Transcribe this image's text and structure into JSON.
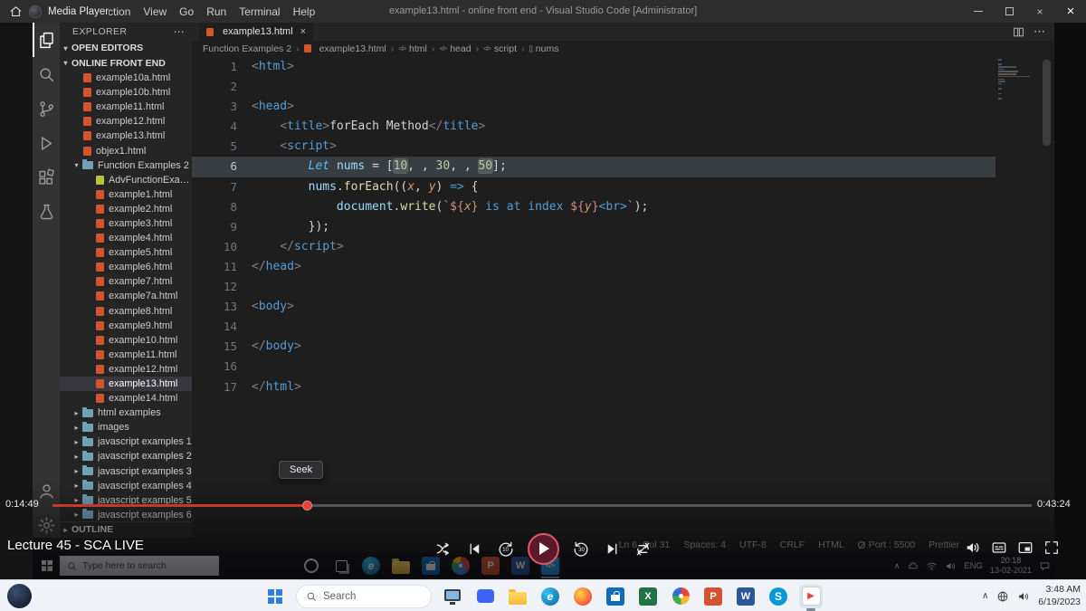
{
  "titlebar": {
    "app": "Media Player",
    "menus": [
      "Selection",
      "View",
      "Go",
      "Run",
      "Terminal",
      "Help"
    ],
    "title": "example13.html - online front end - Visual Studio Code [Administrator]"
  },
  "activity": {
    "top": [
      {
        "name": "explorer",
        "active": true
      },
      {
        "name": "search",
        "active": false
      },
      {
        "name": "source-control",
        "active": false
      },
      {
        "name": "run-debug",
        "active": false
      },
      {
        "name": "extensions",
        "active": false
      },
      {
        "name": "testing",
        "active": false
      }
    ],
    "bottom": [
      {
        "name": "account"
      },
      {
        "name": "settings"
      }
    ]
  },
  "sidebar": {
    "header": "EXPLORER",
    "open_editors": "OPEN EDITORS",
    "root": "ONLINE FRONT END",
    "outline": "OUTLINE",
    "tree": [
      {
        "label": "example10a.html",
        "icon": "html",
        "indent": 1
      },
      {
        "label": "example10b.html",
        "icon": "html",
        "indent": 1
      },
      {
        "label": "example11.html",
        "icon": "html",
        "indent": 1
      },
      {
        "label": "example12.html",
        "icon": "html",
        "indent": 1
      },
      {
        "label": "example13.html",
        "icon": "html",
        "indent": 1
      },
      {
        "label": "objex1.html",
        "icon": "html",
        "indent": 1
      },
      {
        "label": "Function Examples 2",
        "icon": "folder",
        "indent": 1,
        "arrow": "down"
      },
      {
        "label": "AdvFunctionExample...",
        "icon": "js",
        "indent": 2
      },
      {
        "label": "example1.html",
        "icon": "html",
        "indent": 2
      },
      {
        "label": "example2.html",
        "icon": "html",
        "indent": 2
      },
      {
        "label": "example3.html",
        "icon": "html",
        "indent": 2
      },
      {
        "label": "example4.html",
        "icon": "html",
        "indent": 2
      },
      {
        "label": "example5.html",
        "icon": "html",
        "indent": 2
      },
      {
        "label": "example6.html",
        "icon": "html",
        "indent": 2
      },
      {
        "label": "example7.html",
        "icon": "html",
        "indent": 2
      },
      {
        "label": "example7a.html",
        "icon": "html",
        "indent": 2
      },
      {
        "label": "example8.html",
        "icon": "html",
        "indent": 2
      },
      {
        "label": "example9.html",
        "icon": "html",
        "indent": 2
      },
      {
        "label": "example10.html",
        "icon": "html",
        "indent": 2
      },
      {
        "label": "example11.html",
        "icon": "html",
        "indent": 2
      },
      {
        "label": "example12.html",
        "icon": "html",
        "indent": 2
      },
      {
        "label": "example13.html",
        "icon": "html",
        "indent": 2,
        "selected": true
      },
      {
        "label": "example14.html",
        "icon": "html",
        "indent": 2
      },
      {
        "label": "html examples",
        "icon": "folder",
        "indent": 1,
        "arrow": "right"
      },
      {
        "label": "images",
        "icon": "folder",
        "indent": 1,
        "arrow": "right"
      },
      {
        "label": "javascript examples 1",
        "icon": "folder",
        "indent": 1,
        "arrow": "right"
      },
      {
        "label": "javascript examples 2",
        "icon": "folder",
        "indent": 1,
        "arrow": "right"
      },
      {
        "label": "javascript examples 3",
        "icon": "folder",
        "indent": 1,
        "arrow": "right"
      },
      {
        "label": "javascript examples 4",
        "icon": "folder",
        "indent": 1,
        "arrow": "right"
      },
      {
        "label": "javascript examples 5",
        "icon": "folder",
        "indent": 1,
        "arrow": "right"
      },
      {
        "label": "javascript examples 6",
        "icon": "folder",
        "indent": 1,
        "arrow": "right"
      }
    ]
  },
  "editor": {
    "tab": {
      "label": "example13.html"
    },
    "breadcrumbs": [
      "Function Examples 2",
      "example13.html",
      "html",
      "head",
      "script",
      "nums"
    ],
    "active_line": 6,
    "lines": [
      [
        [
          "<",
          "punct"
        ],
        [
          "html",
          "tag"
        ],
        [
          ">",
          "punct"
        ]
      ],
      [],
      [
        [
          "<",
          "punct"
        ],
        [
          "head",
          "tag"
        ],
        [
          ">",
          "punct"
        ]
      ],
      [
        [
          "    ",
          "plain"
        ],
        [
          "<",
          "punct"
        ],
        [
          "title",
          "tag"
        ],
        [
          ">",
          "punct"
        ],
        [
          "forEach Method",
          "plain"
        ],
        [
          "</",
          "punct"
        ],
        [
          "title",
          "tag"
        ],
        [
          ">",
          "punct"
        ]
      ],
      [
        [
          "    ",
          "plain"
        ],
        [
          "<",
          "punct"
        ],
        [
          "script",
          "tag"
        ],
        [
          ">",
          "punct"
        ]
      ],
      [
        [
          "        ",
          "plain"
        ],
        [
          "Let",
          "let"
        ],
        [
          " ",
          "plain"
        ],
        [
          "nums",
          "var"
        ],
        [
          " = [",
          "plain"
        ],
        [
          "10",
          "num box"
        ],
        [
          ", , ",
          "plain"
        ],
        [
          "30",
          "num"
        ],
        [
          ", , ",
          "plain"
        ],
        [
          "50",
          "num box"
        ],
        [
          "];",
          "plain"
        ]
      ],
      [
        [
          "        ",
          "plain"
        ],
        [
          "nums",
          "var"
        ],
        [
          ".",
          "plain"
        ],
        [
          "forEach",
          "fn"
        ],
        [
          "((",
          "plain"
        ],
        [
          "x",
          "param"
        ],
        [
          ", ",
          "plain"
        ],
        [
          "y",
          "param"
        ],
        [
          ") ",
          "plain"
        ],
        [
          "=>",
          "blue"
        ],
        [
          " {",
          "plain"
        ]
      ],
      [
        [
          "            ",
          "plain"
        ],
        [
          "document",
          "var"
        ],
        [
          ".",
          "plain"
        ],
        [
          "write",
          "fn"
        ],
        [
          "(",
          "plain"
        ],
        [
          "`",
          "str"
        ],
        [
          "${",
          "str"
        ],
        [
          "x",
          "param"
        ],
        [
          "}",
          "str"
        ],
        [
          " is at index ",
          "blue"
        ],
        [
          "${",
          "str"
        ],
        [
          "y",
          "param"
        ],
        [
          "}",
          "str"
        ],
        [
          "<br>",
          "blue"
        ],
        [
          "`",
          "str"
        ],
        [
          ");",
          "plain"
        ]
      ],
      [
        [
          "        ",
          "plain"
        ],
        [
          "});",
          "plain"
        ]
      ],
      [
        [
          "    ",
          "plain"
        ],
        [
          "</",
          "punct"
        ],
        [
          "script",
          "tag"
        ],
        [
          ">",
          "punct"
        ]
      ],
      [
        [
          "</",
          "punct"
        ],
        [
          "head",
          "tag"
        ],
        [
          ">",
          "punct"
        ]
      ],
      [],
      [
        [
          "<",
          "punct"
        ],
        [
          "body",
          "tag"
        ],
        [
          ">",
          "punct"
        ]
      ],
      [],
      [
        [
          "</",
          "punct"
        ],
        [
          "body",
          "tag"
        ],
        [
          ">",
          "punct"
        ]
      ],
      [],
      [
        [
          "</",
          "punct"
        ],
        [
          "html",
          "tag"
        ],
        [
          ">",
          "punct"
        ]
      ]
    ],
    "status": [
      "Ln 6, Col 31",
      "Spaces: 4",
      "UTF-8",
      "CRLF",
      "HTML",
      "Port : 5500",
      "Prettier"
    ]
  },
  "player": {
    "elapsed": "0:14:49",
    "duration": "0:43:24",
    "progress_pct": 26,
    "seek_tooltip": "Seek",
    "now_playing": "Lecture 45 - SCA LIVE",
    "controls": [
      "shuffle",
      "previous",
      "rewind-10",
      "play",
      "forward-30",
      "next",
      "repeat-off"
    ],
    "right_controls": [
      "volume",
      "subtitles",
      "miniplayer",
      "fullscreen"
    ],
    "accent_color": "#c8372d"
  },
  "video_taskbar": {
    "search_placeholder": "Type here to search",
    "icons": [
      "cortana",
      "task-view",
      "edge",
      "file-explorer",
      "store",
      "chrome",
      "powerpoint",
      "word",
      "vscode"
    ],
    "active_icon": "vscode",
    "tray": {
      "lang": "ENG",
      "time": "20:18",
      "date": "13-02-2021"
    }
  },
  "taskbar": {
    "search": "Search",
    "icons": [
      "desktop",
      "chat",
      "file-explorer",
      "edge",
      "firefox",
      "store",
      "excel",
      "photos",
      "powerpoint",
      "word",
      "skype",
      "media-player"
    ],
    "active_icon": "media-player",
    "tray": {
      "time": "3:48 AM",
      "date": "6/19/2023"
    }
  }
}
